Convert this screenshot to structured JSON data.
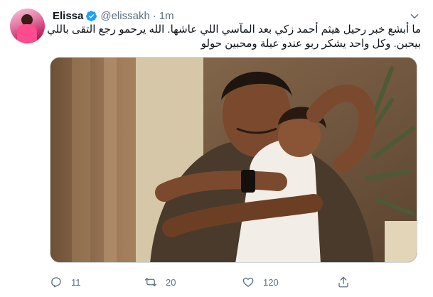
{
  "tweet": {
    "author_name": "Elissa",
    "author_handle": "@elissakh",
    "separator": "·",
    "time": "1m",
    "text_line_1": "ما أبشع خبر رحيل هيثم أحمد زكي بعد المآسي اللي عاشها. الله يرحمو رجع التقى باللي",
    "text_line_2": "بيحبن. وكل واحد يشكر ربو عندو عيلة ومحبين حولو"
  },
  "actions": {
    "reply_count": "11",
    "retweet_count": "20",
    "like_count": "120"
  },
  "icons": {
    "verified": "verified-badge-icon",
    "caret": "chevron-down-icon",
    "reply": "reply-icon",
    "retweet": "retweet-icon",
    "like": "heart-icon",
    "share": "share-icon"
  },
  "colors": {
    "accent": "#1da1f2",
    "secondary_text": "#5b7083",
    "primary_text": "#0f1419"
  }
}
